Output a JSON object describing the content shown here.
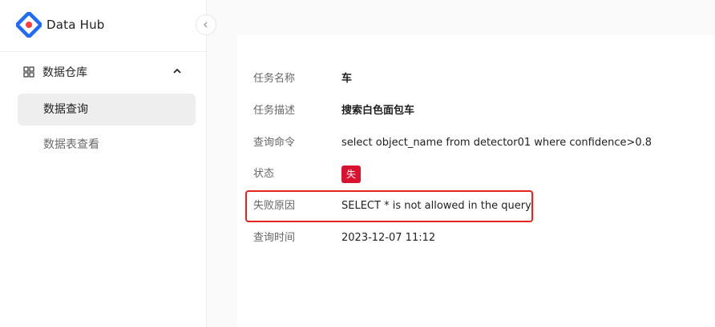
{
  "brand": {
    "name": "Data Hub",
    "logo_icon": "diamond-logo-icon",
    "colors": {
      "blue": "#1f6bff",
      "red": "#ff3d3d"
    }
  },
  "sidebar": {
    "group": {
      "label": "数据仓库",
      "icon": "grid-icon",
      "expanded_icon": "chevron-up-icon"
    },
    "items": [
      {
        "label": "数据查询",
        "active": true
      },
      {
        "label": "数据表查看",
        "active": false
      }
    ]
  },
  "details": {
    "task_name": {
      "label": "任务名称",
      "value": "车"
    },
    "task_desc": {
      "label": "任务描述",
      "value": "搜索白色面包车"
    },
    "query_cmd": {
      "label": "查询命令",
      "value": "select object_name from detector01 where confidence>0.8"
    },
    "status": {
      "label": "状态",
      "value": "失败",
      "color": "#d9132f"
    },
    "fail_reason": {
      "label": "失败原因",
      "value": "SELECT * is not allowed in the query"
    },
    "query_time": {
      "label": "查询时间",
      "value": "2023-12-07 11:12"
    }
  },
  "highlight_color": "#e5231f"
}
